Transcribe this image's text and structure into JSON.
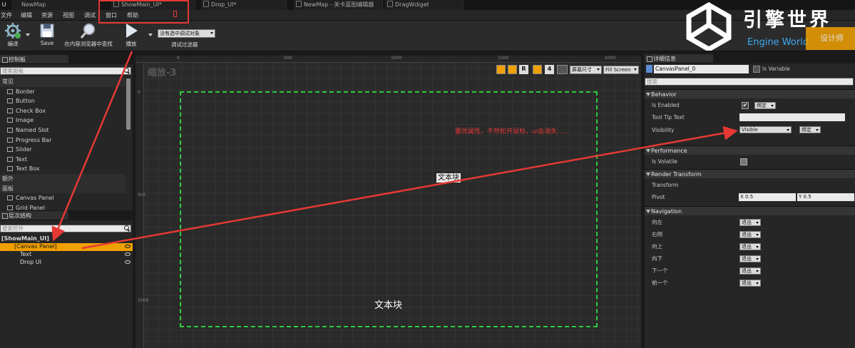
{
  "tabs": [
    {
      "label": "NewMap"
    },
    {
      "label": "ShowMain_UI*"
    },
    {
      "label": "Drop_UI*"
    },
    {
      "label": "NewMap - 关卡蓝图编辑器"
    },
    {
      "label": "DragWdiget"
    }
  ],
  "menu": [
    "文件",
    "编辑",
    "资源",
    "视图",
    "调试",
    "窗口",
    "帮助"
  ],
  "toolbar": {
    "compile_label": "编译",
    "save_label": "Save",
    "browse_label": "在内容浏览器中查找",
    "play_label": "播放",
    "debug_dropdown": "没有选中调试对象",
    "debug_filter_label": "调试过滤器",
    "designer_label": "设计师"
  },
  "watermark": {
    "title": "引擎世界",
    "subtitle": "Engine World"
  },
  "palette": {
    "title": "控制板",
    "search_placeholder": "搜索面板",
    "rows": [
      {
        "label": "常见",
        "type": "cat"
      },
      {
        "label": "Border",
        "type": "item"
      },
      {
        "label": "Button",
        "type": "item"
      },
      {
        "label": "Check Box",
        "type": "item"
      },
      {
        "label": "Image",
        "type": "item"
      },
      {
        "label": "Named Slot",
        "type": "item"
      },
      {
        "label": "Progress Bar",
        "type": "item"
      },
      {
        "label": "Slider",
        "type": "item"
      },
      {
        "label": "Text",
        "type": "item"
      },
      {
        "label": "Text Box",
        "type": "item"
      },
      {
        "label": "额外",
        "type": "cat"
      },
      {
        "label": "面板",
        "type": "cat"
      },
      {
        "label": "Canvas Panel",
        "type": "item"
      },
      {
        "label": "Grid Panel",
        "type": "item"
      }
    ]
  },
  "hierarchy": {
    "title": "层次结构",
    "search_placeholder": "搜索控件",
    "root": "[ShowMain_UI]",
    "selected": "[Canvas Panel]",
    "children": [
      "Text",
      "Drop UI"
    ]
  },
  "canvas": {
    "zoom": "缩放-3",
    "screen_size": "屏幕尺寸",
    "fill_screen": "Fill Screen",
    "text_block_top": "文本块",
    "text_block_bottom": "文本块",
    "annotation": "要改属性，不然松开鼠标，ui会消失......",
    "ruler_h": [
      "0",
      "500",
      "1000",
      "1500",
      "2000"
    ],
    "ruler_v": [
      "0",
      "500",
      "1000"
    ],
    "toggle_r": "R",
    "toggle_4": "4"
  },
  "details": {
    "title": "详细信息",
    "name": "CanvasPanel_0",
    "is_variable": "Is Variable",
    "search_placeholder": "搜索",
    "behavior": {
      "header": "Behavior",
      "is_enabled": "Is Enabled",
      "tool_tip": "Tool Tip Text",
      "visibility": "Visibility",
      "visibility_value": "Visible",
      "bind": "绑定"
    },
    "performance": {
      "header": "Performance",
      "is_volatile": "Is Volatile"
    },
    "render_transform": {
      "header": "Render Transform",
      "transform": "Transform",
      "pivot": "Pivot",
      "x_label": "X",
      "x_value": "0.5",
      "y_label": "Y",
      "y_value": "0.5"
    },
    "navigation": {
      "header": "Navigation",
      "items": [
        {
          "label": "向左",
          "value": "退出"
        },
        {
          "label": "右侧",
          "value": "退出"
        },
        {
          "label": "向上",
          "value": "退出"
        },
        {
          "label": "向下",
          "value": "退出"
        },
        {
          "label": "下一个",
          "value": "退出"
        },
        {
          "label": "前一个",
          "value": "退出"
        }
      ]
    }
  },
  "colors": {
    "accent": "#f0a000",
    "annotation_red": "#e53935",
    "canvas_border": "#2ecc40"
  }
}
